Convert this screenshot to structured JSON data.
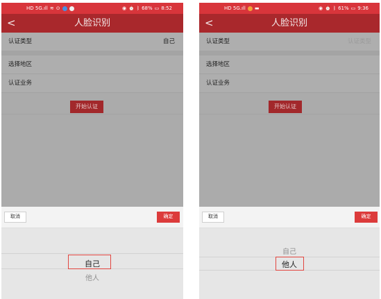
{
  "left": {
    "status": {
      "carrier_icons": "HD 5G.ıll",
      "battery": "68%",
      "time": "8:52"
    },
    "title": "人脸识别",
    "rows": {
      "type_label": "认证类型",
      "type_value": "自己",
      "region_label": "选择地区",
      "business_label": "认证业务"
    },
    "start_label": "开始认证",
    "picker": {
      "cancel": "取消",
      "confirm": "确定",
      "options": [
        "自己",
        "他人"
      ],
      "selected_index": 0
    }
  },
  "right": {
    "status": {
      "carrier_icons": "HD 5G.ıll",
      "battery": "61%",
      "time": "9:36"
    },
    "title": "人脸识别",
    "rows": {
      "type_label": "认证类型",
      "type_placeholder": "认证类型",
      "region_label": "选择地区",
      "business_label": "认证业务"
    },
    "start_label": "开始认证",
    "picker": {
      "cancel": "取消",
      "confirm": "确定",
      "options": [
        "自己",
        "他人"
      ],
      "selected_index": 1
    }
  },
  "colors": {
    "status_bar": "#d8353b",
    "app_bar": "#a9282c",
    "highlight": "#e2453f",
    "confirm": "#dc3b3b"
  }
}
